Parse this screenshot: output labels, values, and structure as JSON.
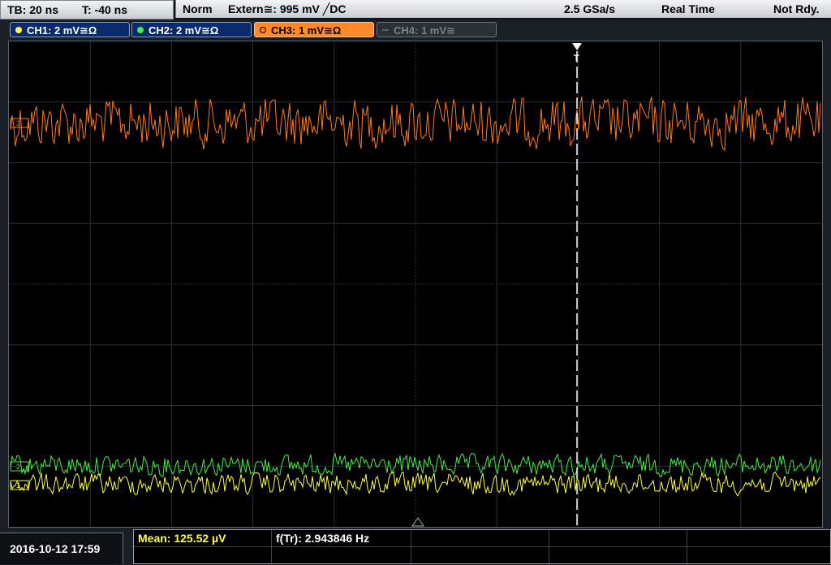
{
  "status_bar": {
    "timebase": "TB: 20 ns",
    "trigger_time": "T: -40 ns",
    "trigger_mode": "Norm",
    "trigger_source": "Extern≅: 995 mV ╱DC",
    "sample_rate": "2.5 GSa/s",
    "acq_mode": "Real Time",
    "status": "Not Rdy."
  },
  "channels": [
    {
      "label": "CH1: 2 mV≅Ω",
      "color": "#ffff40",
      "active": true
    },
    {
      "label": "CH2: 2 mV≅Ω",
      "color": "#44ee44",
      "active": true
    },
    {
      "label": "CH3: 1 mV≅Ω",
      "color": "#ff7a1a",
      "active": true
    },
    {
      "label": "CH4: 1 mV≅",
      "color": "#7d838c",
      "active": false
    }
  ],
  "markers": {
    "ch1": "1",
    "ch2": "2",
    "ch3": "3",
    "trigger": "T"
  },
  "colors": {
    "ch1": "#ffff40",
    "ch2": "#44ee44",
    "ch3": "#ff7a1a",
    "grid": "#2a3038",
    "trigger_line": "#ffffff"
  },
  "footer": {
    "datetime": "2016-10-12 17:59",
    "mean_label": "Mean: 125.52 µV",
    "freq_label": "f(Tr): 2.943846 Hz"
  }
}
